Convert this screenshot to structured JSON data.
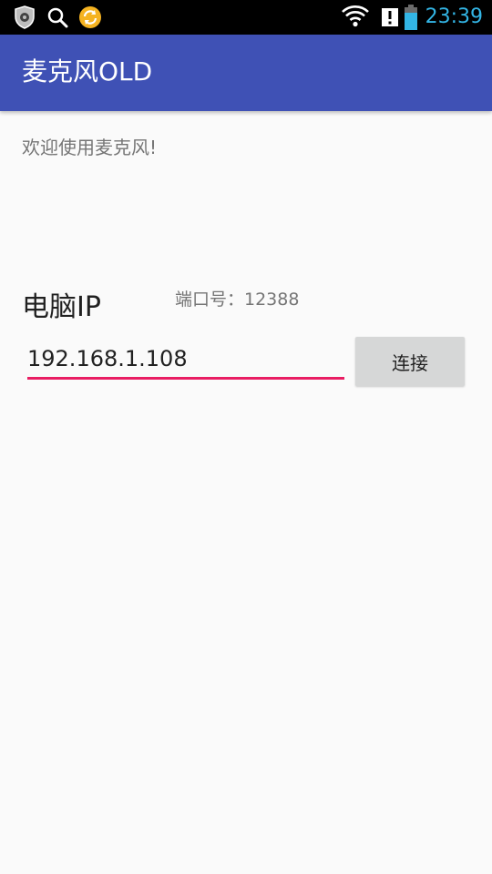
{
  "status_bar": {
    "time": "23:39",
    "icons": [
      "shield-app-icon",
      "search-icon",
      "sync-app-icon",
      "wifi-icon",
      "alert-icon",
      "battery-icon"
    ],
    "time_color": "#33b5e5"
  },
  "app_bar": {
    "title": "麦克风OLD",
    "color": "#3f51b5"
  },
  "main": {
    "welcome_text": "欢迎使用麦克风!",
    "ip_label": "电脑IP",
    "port_label": "端口号：12388",
    "ip_input_value": "192.168.1.108",
    "connect_label": "连接",
    "accent_color": "#e91e63"
  }
}
